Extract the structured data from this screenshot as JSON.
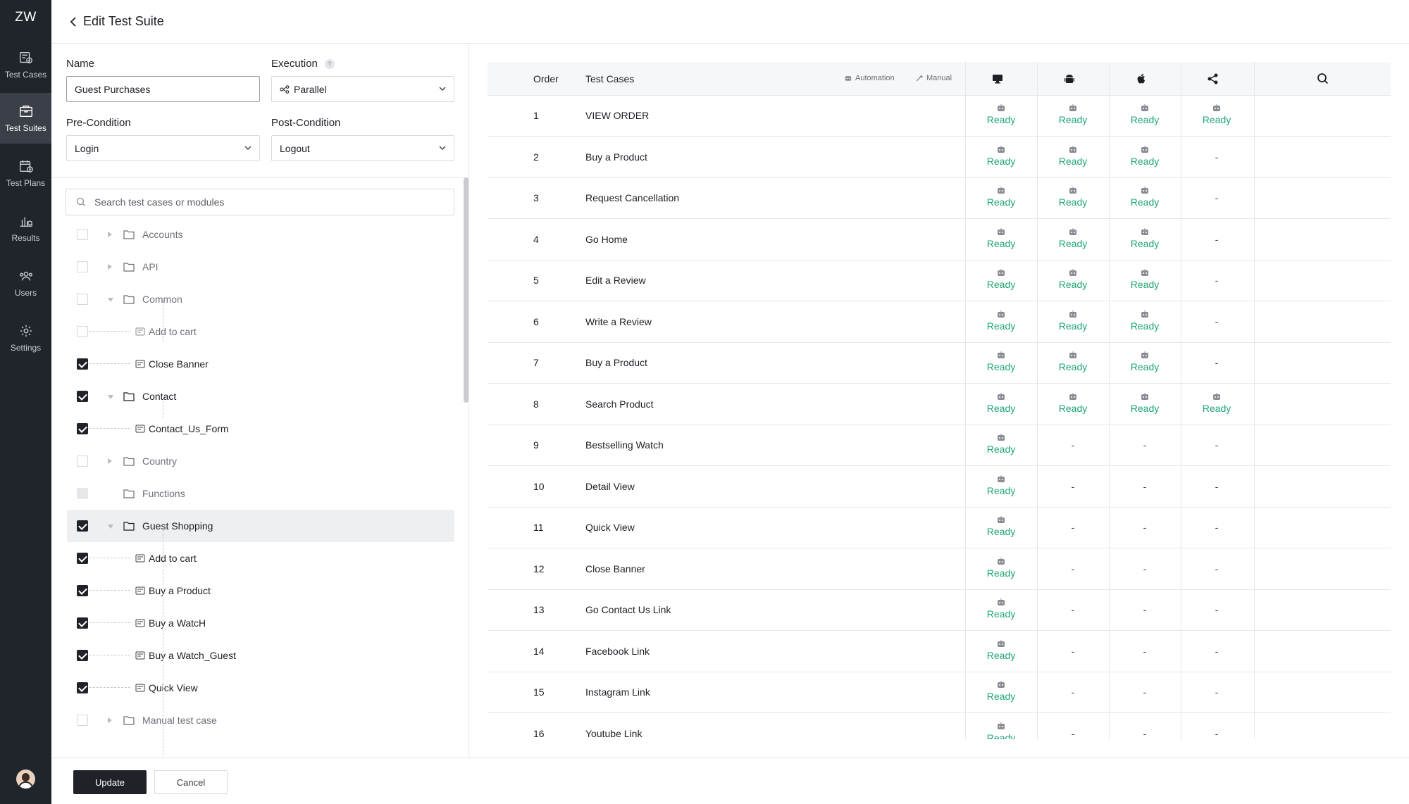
{
  "app": {
    "logo": "ZW",
    "header_title": "Edit Test Suite"
  },
  "nav": {
    "items": [
      {
        "label": "Test Cases",
        "icon": "test-cases-icon"
      },
      {
        "label": "Test Suites",
        "icon": "test-suites-icon",
        "active": true
      },
      {
        "label": "Test Plans",
        "icon": "test-plans-icon"
      },
      {
        "label": "Results",
        "icon": "results-icon"
      },
      {
        "label": "Users",
        "icon": "users-icon"
      },
      {
        "label": "Settings",
        "icon": "settings-icon"
      }
    ]
  },
  "form": {
    "name_label": "Name",
    "name_value": "Guest Purchases",
    "execution_label": "Execution",
    "execution_value": "Parallel",
    "execution_help": "?",
    "precondition_label": "Pre-Condition",
    "precondition_value": "Login",
    "postcondition_label": "Post-Condition",
    "postcondition_value": "Logout",
    "search_placeholder": "Search test cases or modules"
  },
  "tree": [
    {
      "label": "Accounts",
      "type": "folder",
      "state": "off",
      "caret": "right",
      "muted": true
    },
    {
      "label": "API",
      "type": "folder",
      "state": "off",
      "caret": "right",
      "muted": true
    },
    {
      "label": "Common",
      "type": "folder",
      "state": "off",
      "caret": "down",
      "muted": true
    },
    {
      "label": "Add to cart",
      "type": "case",
      "state": "off",
      "muted": true
    },
    {
      "label": "Close Banner",
      "type": "case",
      "state": "on"
    },
    {
      "label": "Contact",
      "type": "folder",
      "state": "on",
      "caret": "down"
    },
    {
      "label": "Contact_Us_Form",
      "type": "case",
      "state": "on"
    },
    {
      "label": "Country",
      "type": "folder",
      "state": "off",
      "caret": "right",
      "muted": true
    },
    {
      "label": "Functions",
      "type": "folder",
      "state": "dis",
      "muted": true
    },
    {
      "label": "Guest Shopping",
      "type": "folder",
      "state": "on",
      "caret": "down",
      "highlight": true
    },
    {
      "label": "Add to cart",
      "type": "case",
      "state": "on"
    },
    {
      "label": "Buy a Product",
      "type": "case",
      "state": "on"
    },
    {
      "label": "Buy a WatcH",
      "type": "case",
      "state": "on"
    },
    {
      "label": "Buy a Watch_Guest",
      "type": "case",
      "state": "on"
    },
    {
      "label": "Quick View",
      "type": "case",
      "state": "on"
    },
    {
      "label": "Manual test case",
      "type": "folder",
      "state": "off",
      "caret": "right",
      "muted": true
    }
  ],
  "footer": {
    "update_label": "Update",
    "cancel_label": "Cancel"
  },
  "table": {
    "order_header": "Order",
    "cases_header": "Test Cases",
    "legend_automation": "Automation",
    "legend_manual": "Manual",
    "platforms": [
      "desktop-icon",
      "android-icon",
      "apple-icon",
      "share-icon"
    ],
    "status_ready": "Ready",
    "status_none": "-",
    "rows": [
      {
        "order": "1",
        "name": "VIEW ORDER",
        "status": [
          1,
          1,
          1,
          1
        ]
      },
      {
        "order": "2",
        "name": "Buy a Product",
        "status": [
          1,
          1,
          1,
          0
        ]
      },
      {
        "order": "3",
        "name": "Request Cancellation",
        "status": [
          1,
          1,
          1,
          0
        ]
      },
      {
        "order": "4",
        "name": "Go Home",
        "status": [
          1,
          1,
          1,
          0
        ]
      },
      {
        "order": "5",
        "name": "Edit a Review",
        "status": [
          1,
          1,
          1,
          0
        ]
      },
      {
        "order": "6",
        "name": "Write a Review",
        "status": [
          1,
          1,
          1,
          0
        ]
      },
      {
        "order": "7",
        "name": "Buy a Product",
        "status": [
          1,
          1,
          1,
          0
        ]
      },
      {
        "order": "8",
        "name": "Search Product",
        "status": [
          1,
          1,
          1,
          1
        ]
      },
      {
        "order": "9",
        "name": "Bestselling Watch",
        "status": [
          1,
          0,
          0,
          0
        ]
      },
      {
        "order": "10",
        "name": "Detail View",
        "status": [
          1,
          0,
          0,
          0
        ]
      },
      {
        "order": "11",
        "name": "Quick View",
        "status": [
          1,
          0,
          0,
          0
        ]
      },
      {
        "order": "12",
        "name": "Close Banner",
        "status": [
          1,
          0,
          0,
          0
        ]
      },
      {
        "order": "13",
        "name": "Go Contact Us Link",
        "status": [
          1,
          0,
          0,
          0
        ]
      },
      {
        "order": "14",
        "name": "Facebook Link",
        "status": [
          1,
          0,
          0,
          0
        ]
      },
      {
        "order": "15",
        "name": "Instagram Link",
        "status": [
          1,
          0,
          0,
          0
        ]
      },
      {
        "order": "16",
        "name": "Youtube Link",
        "status": [
          1,
          0,
          0,
          0
        ]
      }
    ]
  }
}
